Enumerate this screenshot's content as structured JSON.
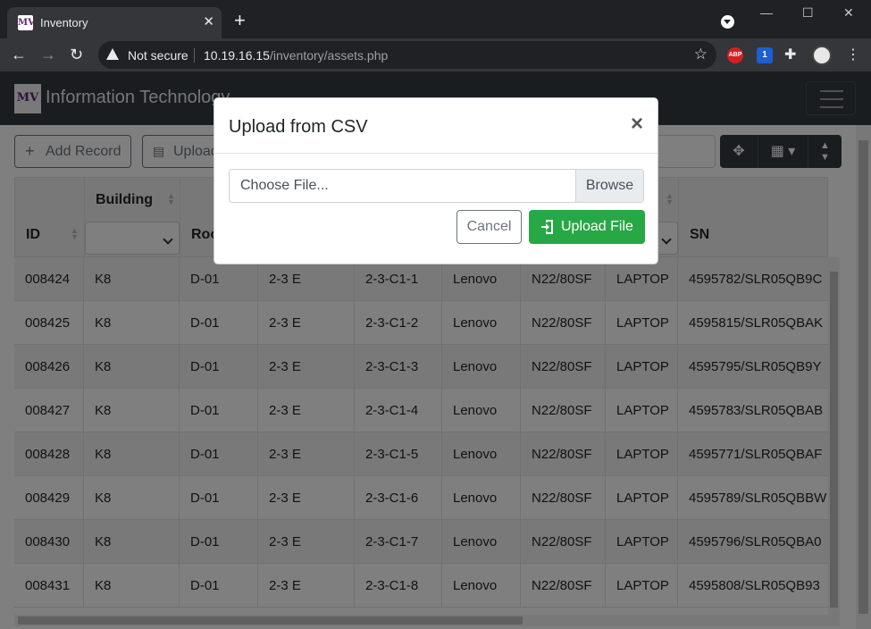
{
  "browser": {
    "tab_title": "Inventory",
    "tab_favicon": "MV",
    "close_glyph": "✕",
    "newtab_glyph": "+",
    "security_label": "Not secure",
    "url_host": "10.19.16.15",
    "url_path": "/inventory/assets.php",
    "extensions": {
      "abp_label": "ABP",
      "bw_badge": "1"
    }
  },
  "navbar": {
    "brand_logo": "MV",
    "brand_text": "Information Technology"
  },
  "toolbar": {
    "add_record_label": "Add Record",
    "upload_label": "Upload"
  },
  "table": {
    "headers": {
      "id": "ID",
      "building": "Building",
      "room": "Room",
      "sn": "SN"
    },
    "rows": [
      [
        "008424",
        "K8",
        "D-01",
        "2-3 E",
        "2-3-C1-1",
        "Lenovo",
        "N22/80SF",
        "LAPTOP",
        "4595782/SLR05QB9C"
      ],
      [
        "008425",
        "K8",
        "D-01",
        "2-3 E",
        "2-3-C1-2",
        "Lenovo",
        "N22/80SF",
        "LAPTOP",
        "4595815/SLR05QBAK"
      ],
      [
        "008426",
        "K8",
        "D-01",
        "2-3 E",
        "2-3-C1-3",
        "Lenovo",
        "N22/80SF",
        "LAPTOP",
        "4595795/SLR05QB9Y"
      ],
      [
        "008427",
        "K8",
        "D-01",
        "2-3 E",
        "2-3-C1-4",
        "Lenovo",
        "N22/80SF",
        "LAPTOP",
        "4595783/SLR05QBAB"
      ],
      [
        "008428",
        "K8",
        "D-01",
        "2-3 E",
        "2-3-C1-5",
        "Lenovo",
        "N22/80SF",
        "LAPTOP",
        "4595771/SLR05QBAF"
      ],
      [
        "008429",
        "K8",
        "D-01",
        "2-3 E",
        "2-3-C1-6",
        "Lenovo",
        "N22/80SF",
        "LAPTOP",
        "4595789/SLR05QBBW"
      ],
      [
        "008430",
        "K8",
        "D-01",
        "2-3 E",
        "2-3-C1-7",
        "Lenovo",
        "N22/80SF",
        "LAPTOP",
        "4595796/SLR05QBA0"
      ],
      [
        "008431",
        "K8",
        "D-01",
        "2-3 E",
        "2-3-C1-8",
        "Lenovo",
        "N22/80SF",
        "LAPTOP",
        "4595808/SLR05QB93"
      ]
    ]
  },
  "modal": {
    "title": "Upload from CSV",
    "close_glyph": "×",
    "file_placeholder": "Choose File...",
    "browse_label": "Browse",
    "cancel_label": "Cancel",
    "upload_label": "Upload File"
  },
  "colors": {
    "navbar_bg": "#343a40",
    "success": "#28a745",
    "secondary": "#6c757d"
  },
  "icons": [
    "plus-icon",
    "file-csv-icon",
    "arrows-move-icon",
    "table-icon",
    "sort-icon",
    "sign-in-icon",
    "hamburger-icon"
  ]
}
